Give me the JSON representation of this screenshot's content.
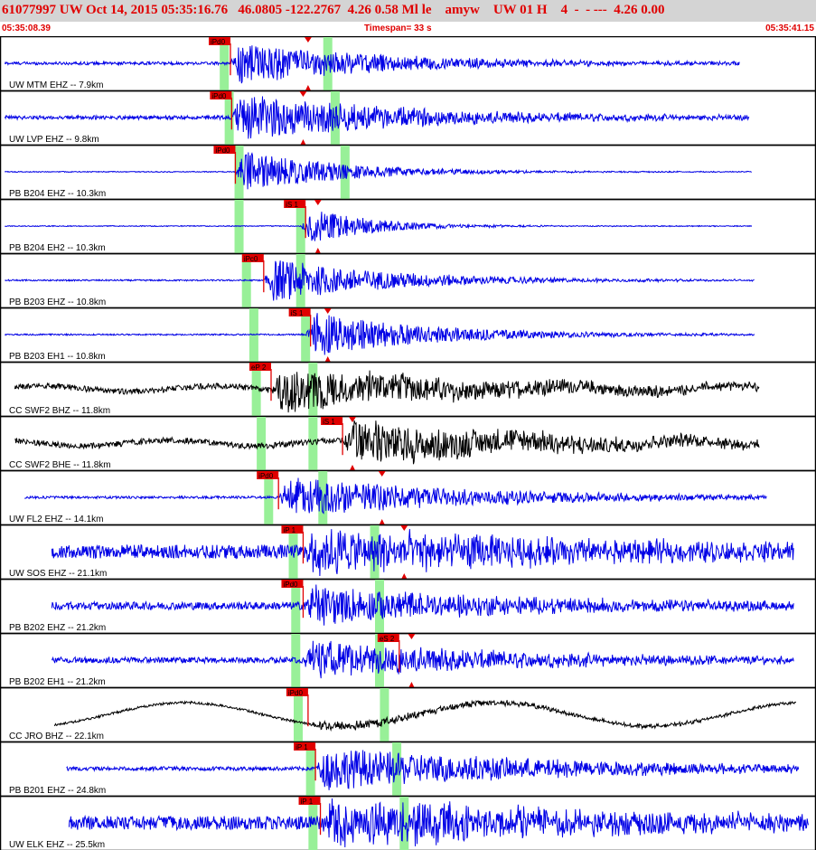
{
  "header": {
    "title": "61077997 UW Oct 14, 2015 05:35:16.76   46.0805 -122.2767  4.26 0.58 Ml le    amyw    UW 01 H    4  -  - ---  4.26 0.00",
    "start_time": "05:35:08.39",
    "timespan": "Timespan=  33 s",
    "end_time": "05:35:41.15"
  },
  "colors": {
    "trace_blue": "#0000e6",
    "trace_black": "#000000",
    "pick_red": "#e00000",
    "pick_window_green": "#98f098",
    "title_red": "#e00000",
    "header_bg": "#d4d4d4"
  },
  "channels": [
    {
      "label": "UW MTM EHZ -- 7.9km",
      "color": "blue",
      "pick": "iPd0",
      "pick_t": 9.35,
      "green": [
        9.1,
        13.3
      ],
      "s_marker": 12.5,
      "start": 0.2,
      "end": 30.0,
      "onset": 9.35,
      "amp": 0.9,
      "noise": 0.06,
      "period": 0.35,
      "decay": 6
    },
    {
      "label": "UW LVP EHZ -- 9.8km",
      "color": "blue",
      "pick": "iPd0",
      "pick_t": 9.4,
      "green": [
        9.3,
        13.6
      ],
      "s_marker": 12.3,
      "start": 0.2,
      "end": 30.4,
      "onset": 9.4,
      "amp": 1.0,
      "noise": 0.08,
      "period": 0.3,
      "decay": 7
    },
    {
      "label": "PB B204 EHZ -- 10.3km",
      "color": "blue",
      "pick": "iPd0",
      "pick_t": 9.55,
      "green": [
        9.7,
        14.0
      ],
      "s_marker": null,
      "start": 0.2,
      "end": 30.5,
      "onset": 9.55,
      "amp": 0.95,
      "noise": 0.02,
      "period": 0.3,
      "decay": 4
    },
    {
      "label": "PB B204 EH2 -- 10.3km",
      "color": "blue",
      "pick": "iS 1",
      "pick_t": 12.4,
      "green": [
        9.7,
        12.2
      ],
      "s_marker": 12.9,
      "start": 0.2,
      "end": 30.5,
      "onset": 12.2,
      "amp": 0.9,
      "noise": 0.02,
      "period": 0.3,
      "decay": 2.5
    },
    {
      "label": "PB B203 EHZ -- 10.8km",
      "color": "blue",
      "pick": "iPc0",
      "pick_t": 10.7,
      "green": [
        10.0,
        12.2
      ],
      "s_marker": null,
      "start": 0.2,
      "end": 30.6,
      "onset": 10.7,
      "amp": 0.95,
      "noise": 0.03,
      "period": 0.3,
      "decay": 5
    },
    {
      "label": "PB B203 EH1 -- 10.8km",
      "color": "blue",
      "pick": "iS 1",
      "pick_t": 12.6,
      "green": [
        10.3,
        12.4
      ],
      "s_marker": 13.3,
      "start": 0.2,
      "end": 30.6,
      "onset": 12.4,
      "amp": 0.95,
      "noise": 0.03,
      "period": 0.3,
      "decay": 5
    },
    {
      "label": "CC SWF2 BHZ -- 11.8km",
      "color": "black",
      "pick": "eP 2",
      "pick_t": 11.0,
      "green": [
        10.4,
        12.7
      ],
      "s_marker": null,
      "start": 0.6,
      "end": 30.8,
      "onset": 11.0,
      "amp": 0.9,
      "noise": 0.12,
      "period": 0.35,
      "decay": 9
    },
    {
      "label": "CC SWF2 BHE -- 11.8km",
      "color": "black",
      "pick": "iS 1",
      "pick_t": 13.9,
      "green": [
        10.6,
        12.7
      ],
      "s_marker": 14.3,
      "start": 0.6,
      "end": 30.8,
      "onset": 13.9,
      "amp": 0.9,
      "noise": 0.12,
      "period": 0.35,
      "decay": 9
    },
    {
      "label": "UW FL2 EHZ -- 14.1km",
      "color": "blue",
      "pick": "iPd0",
      "pick_t": 11.3,
      "green": [
        10.9,
        13.1
      ],
      "s_marker": 15.5,
      "start": 1.0,
      "end": 31.1,
      "onset": 11.3,
      "amp": 0.85,
      "noise": 0.05,
      "period": 0.35,
      "decay": 8
    },
    {
      "label": "UW SOS EHZ -- 21.1km",
      "color": "blue",
      "pick": "iP 1",
      "pick_t": 12.3,
      "green": [
        11.9,
        15.2
      ],
      "s_marker": 16.4,
      "start": 2.1,
      "end": 32.2,
      "onset": 12.3,
      "amp": 0.95,
      "noise": 0.28,
      "period": 0.25,
      "decay": 12
    },
    {
      "label": "PB B202 EHZ -- 21.2km",
      "color": "blue",
      "pick": "iPd0",
      "pick_t": 12.3,
      "green": [
        12.0,
        15.4
      ],
      "s_marker": null,
      "start": 2.1,
      "end": 32.2,
      "onset": 12.3,
      "amp": 0.85,
      "noise": 0.16,
      "period": 0.25,
      "decay": 8
    },
    {
      "label": "PB B202 EH1 -- 21.2km",
      "color": "blue",
      "pick": "eS 2",
      "pick_t": 16.2,
      "green": [
        12.0,
        15.4
      ],
      "s_marker": 16.7,
      "start": 2.1,
      "end": 32.2,
      "onset": 12.3,
      "amp": 0.85,
      "noise": 0.12,
      "period": 0.25,
      "decay": 8
    },
    {
      "label": "CC JRO BHZ -- 22.1km",
      "color": "black",
      "pick": "iPd0",
      "pick_t": 12.5,
      "green": [
        12.1,
        15.6
      ],
      "s_marker": null,
      "start": 2.2,
      "end": 32.3,
      "onset": 12.5,
      "amp": 0.2,
      "noise": 0.05,
      "period": 0.4,
      "decay": 10
    },
    {
      "label": "PB B201 EHZ -- 24.8km",
      "color": "blue",
      "pick": "iP 1",
      "pick_t": 12.8,
      "green": [
        12.6,
        16.1
      ],
      "s_marker": null,
      "start": 2.7,
      "end": 32.4,
      "onset": 12.8,
      "amp": 0.9,
      "noise": 0.08,
      "period": 0.25,
      "decay": 10
    },
    {
      "label": "UW ELK EHZ -- 25.5km",
      "color": "blue",
      "pick": "iP 1",
      "pick_t": 13.0,
      "green": [
        12.7,
        16.4
      ],
      "s_marker": null,
      "start": 2.8,
      "end": 32.8,
      "onset": 13.0,
      "amp": 0.95,
      "noise": 0.28,
      "period": 0.25,
      "decay": 12
    }
  ]
}
